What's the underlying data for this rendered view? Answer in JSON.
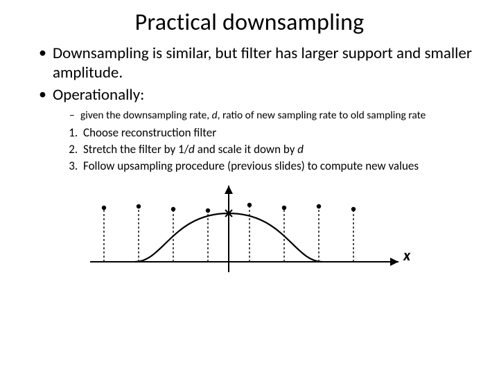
{
  "title": "Practical downsampling",
  "bullets": {
    "b1": "Downsampling is similar, but filter has larger support and smaller amplitude.",
    "b2": "Operationally:",
    "sub1_pre": "given the downsampling rate, ",
    "sub1_d": "d",
    "sub1_post": ", ratio of new sampling rate to old sampling rate",
    "step1": "Choose reconstruction filter",
    "step2_pre": "Stretch the filter by 1/",
    "step2_d1": "d",
    "step2_mid": " and scale it down by ",
    "step2_d2": "d",
    "step3": "Follow upsampling procedure (previous slides) to compute new values"
  },
  "figure": {
    "axis_label": "x",
    "sample_x": [
      -180,
      -130,
      -80,
      -30,
      30,
      80,
      130,
      180
    ],
    "sample_y": [
      78,
      80,
      76,
      74,
      82,
      78,
      80,
      76
    ],
    "filter_peak": 66
  }
}
